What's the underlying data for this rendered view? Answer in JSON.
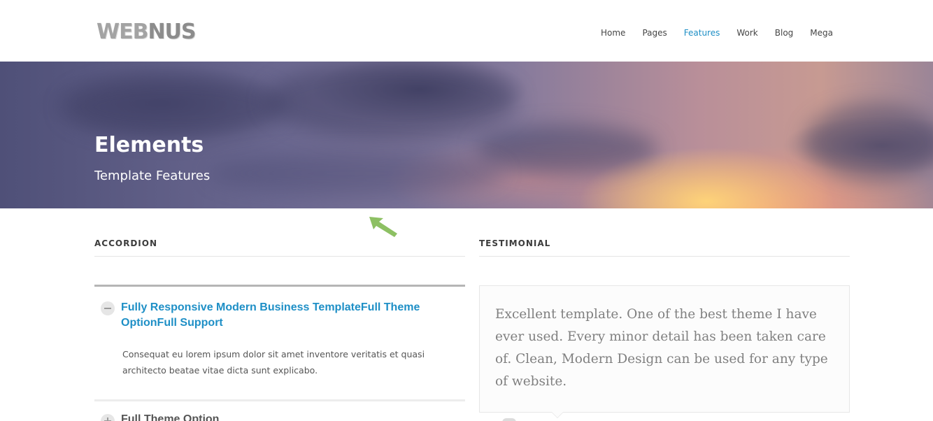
{
  "header": {
    "logo_part1": "WEB",
    "logo_part2": "NUS",
    "nav": [
      {
        "label": "Home",
        "active": false
      },
      {
        "label": "Pages",
        "active": false
      },
      {
        "label": "Features",
        "active": true
      },
      {
        "label": "Work",
        "active": false
      },
      {
        "label": "Blog",
        "active": false
      },
      {
        "label": "Mega",
        "active": false
      }
    ],
    "active_color": "#1e8fc6"
  },
  "hero": {
    "title": "Elements",
    "subtitle": "Template Features"
  },
  "annotation": {
    "arrow_icon": "arrow-up-left-icon",
    "arrow_color": "#8dc063"
  },
  "accordion": {
    "heading": "ACCORDION",
    "items": [
      {
        "title": "Fully Responsive Modern Business TemplateFull Theme OptionFull Support",
        "body": "Consequat eu lorem ipsum dolor sit amet inventore veritatis et quasi architecto beatae vitae dicta sunt explicabo.",
        "expanded": true,
        "icon": "minus-icon"
      },
      {
        "title": "Full Theme Option",
        "expanded": false,
        "icon": "plus-icon"
      }
    ]
  },
  "testimonial": {
    "heading": "TESTIMONIAL",
    "quote": "Excellent template. One of the best theme I have ever used. Every minor detail has been taken care of. Clean, Modern Design can be used for any type of website."
  }
}
